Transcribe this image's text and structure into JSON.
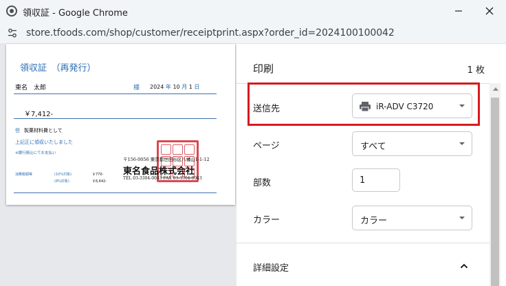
{
  "window": {
    "title": "領収証 - Google Chrome",
    "url": "store.tfoods.com/shop/customer/receiptprint.aspx?order_id=2024100100042"
  },
  "receipt": {
    "title": "領収証　（再発行）",
    "customer": "東名　太郎",
    "honorific": "様",
    "date_year": "2024",
    "date_year_unit": "年",
    "date_month": "10",
    "date_month_unit": "月",
    "date_day": "1",
    "date_day_unit": "日",
    "amount": "￥7,412-",
    "tadashi_mark": "但",
    "purpose": "製菓材料費として",
    "received_note": "上記正に領収いたしました",
    "bank_note": "※銀行振込にてお支払い",
    "breakdown_label": "消費税額等",
    "tax_rate_1": "(10%対象)",
    "tax_rate_2": "(8%対象)",
    "tax_value_1": "￥770-",
    "tax_value_2": "￥6,642-",
    "address": "〒156-0056 東京都世田谷区八幡山1-1-12",
    "company": "東名食品株式会社",
    "tel": "TEL 03-3304-0043 FAX 03-3304-0043"
  },
  "panel": {
    "title": "印刷",
    "sheet_count": "1 枚",
    "destination_label": "送信先",
    "destination_value": "iR-ADV C3720",
    "pages_label": "ページ",
    "pages_value": "すべて",
    "copies_label": "部数",
    "copies_value": "1",
    "color_label": "カラー",
    "color_value": "カラー",
    "advanced_label": "詳細設定"
  },
  "colors": {
    "highlight": "#d7191e",
    "receipt_blue": "#2f6fb3",
    "seal_red": "#d22832"
  },
  "icons": {
    "app": "chrome-icon",
    "site_info": "tune-icon",
    "printer": "printer-icon"
  }
}
